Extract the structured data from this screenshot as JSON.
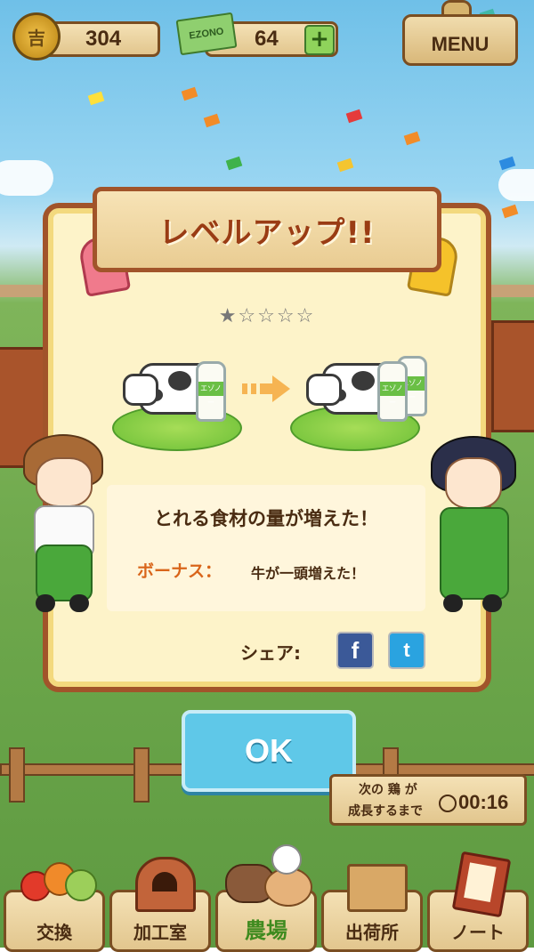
{
  "hud": {
    "coin_icon": "coin-icon",
    "coin_glyph": "吉",
    "coins": "304",
    "ticket_brand": "EZONO",
    "tickets": "64",
    "plus_label": "+",
    "menu_label": "MENU"
  },
  "dialog": {
    "title": "レベルアップ!!",
    "stars": "★☆☆☆☆",
    "bottle_label": "エゾノー",
    "main_message": "とれる食材の量が増えた！",
    "bonus_label": "ボーナス：",
    "bonus_text": "牛が一頭増えた！",
    "share_label": "シェア:",
    "facebook_glyph": "f",
    "twitter_glyph": "t",
    "ok_label": "OK"
  },
  "timer": {
    "line1": "次の 鶏 が",
    "line2": "成長するまで",
    "time": "00:16"
  },
  "nav": {
    "items": [
      {
        "label": "交換",
        "icon": "vegetables-icon"
      },
      {
        "label": "加工室",
        "icon": "brick-oven-icon"
      },
      {
        "label": "農場",
        "icon": "farm-animals-icon"
      },
      {
        "label": "出荷所",
        "icon": "shipping-box-icon"
      },
      {
        "label": "ノート",
        "icon": "notebook-icon"
      }
    ],
    "active": "農場"
  },
  "colors": {
    "accent_brown": "#a1542a",
    "ok_blue": "#5fc8e8",
    "active_green": "#3f8b1f",
    "bonus_orange": "#d9651a"
  }
}
